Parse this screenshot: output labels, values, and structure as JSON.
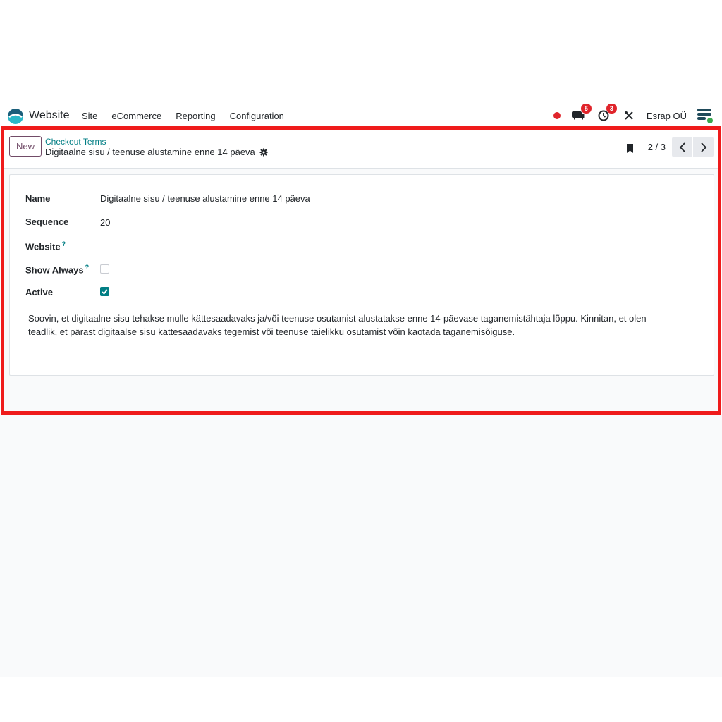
{
  "navbar": {
    "app_name": "Website",
    "menu": [
      "Site",
      "eCommerce",
      "Reporting",
      "Configuration"
    ],
    "messages_count": "5",
    "activities_count": "3",
    "company": "Esrap OÜ",
    "icons": [
      "recording-dot-icon",
      "chat-icon",
      "clock-icon",
      "tools-icon",
      "avatar-icon"
    ]
  },
  "control_panel": {
    "new_label": "New",
    "breadcrumb": "Checkout Terms",
    "record_title": "Digitaalne sisu / teenuse alustamine enne 14 päeva",
    "pager_value": "2 / 3"
  },
  "form": {
    "name_label": "Name",
    "name_value": "Digitaalne sisu / teenuse alustamine enne 14 päeva",
    "sequence_label": "Sequence",
    "sequence_value": "20",
    "website_label": "Website",
    "website_value": "",
    "show_always_label": "Show Always",
    "show_always_checked": false,
    "active_label": "Active",
    "active_checked": true,
    "help_mark": "?",
    "description": "Soovin, et digitaalne sisu tehakse mulle kättesaadavaks ja/või teenuse osutamist alustatakse enne 14-päevase taganemistähtaja lõppu. Kinnitan, et olen teadlik, et pärast digitaalse sisu kättesaadavaks tegemist või teenuse täielikku osutamist võin kaotada taganemisõiguse."
  },
  "colors": {
    "accent": "#017e84",
    "brand": "#714b67",
    "badge": "#e0242b",
    "highlight": "#ef1b1b"
  }
}
